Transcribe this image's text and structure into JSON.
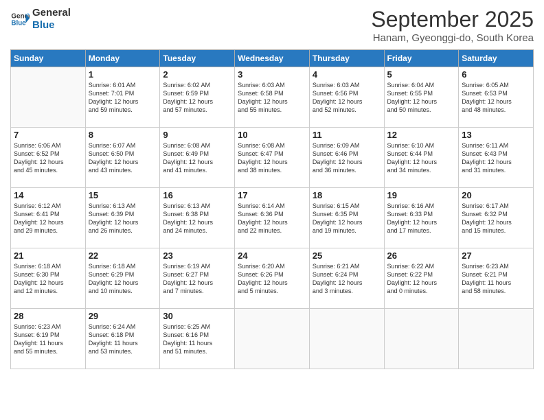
{
  "logo": {
    "line1": "General",
    "line2": "Blue"
  },
  "title": "September 2025",
  "subtitle": "Hanam, Gyeonggi-do, South Korea",
  "weekdays": [
    "Sunday",
    "Monday",
    "Tuesday",
    "Wednesday",
    "Thursday",
    "Friday",
    "Saturday"
  ],
  "weeks": [
    [
      {
        "day": "",
        "info": ""
      },
      {
        "day": "1",
        "info": "Sunrise: 6:01 AM\nSunset: 7:01 PM\nDaylight: 12 hours\nand 59 minutes."
      },
      {
        "day": "2",
        "info": "Sunrise: 6:02 AM\nSunset: 6:59 PM\nDaylight: 12 hours\nand 57 minutes."
      },
      {
        "day": "3",
        "info": "Sunrise: 6:03 AM\nSunset: 6:58 PM\nDaylight: 12 hours\nand 55 minutes."
      },
      {
        "day": "4",
        "info": "Sunrise: 6:03 AM\nSunset: 6:56 PM\nDaylight: 12 hours\nand 52 minutes."
      },
      {
        "day": "5",
        "info": "Sunrise: 6:04 AM\nSunset: 6:55 PM\nDaylight: 12 hours\nand 50 minutes."
      },
      {
        "day": "6",
        "info": "Sunrise: 6:05 AM\nSunset: 6:53 PM\nDaylight: 12 hours\nand 48 minutes."
      }
    ],
    [
      {
        "day": "7",
        "info": "Sunrise: 6:06 AM\nSunset: 6:52 PM\nDaylight: 12 hours\nand 45 minutes."
      },
      {
        "day": "8",
        "info": "Sunrise: 6:07 AM\nSunset: 6:50 PM\nDaylight: 12 hours\nand 43 minutes."
      },
      {
        "day": "9",
        "info": "Sunrise: 6:08 AM\nSunset: 6:49 PM\nDaylight: 12 hours\nand 41 minutes."
      },
      {
        "day": "10",
        "info": "Sunrise: 6:08 AM\nSunset: 6:47 PM\nDaylight: 12 hours\nand 38 minutes."
      },
      {
        "day": "11",
        "info": "Sunrise: 6:09 AM\nSunset: 6:46 PM\nDaylight: 12 hours\nand 36 minutes."
      },
      {
        "day": "12",
        "info": "Sunrise: 6:10 AM\nSunset: 6:44 PM\nDaylight: 12 hours\nand 34 minutes."
      },
      {
        "day": "13",
        "info": "Sunrise: 6:11 AM\nSunset: 6:43 PM\nDaylight: 12 hours\nand 31 minutes."
      }
    ],
    [
      {
        "day": "14",
        "info": "Sunrise: 6:12 AM\nSunset: 6:41 PM\nDaylight: 12 hours\nand 29 minutes."
      },
      {
        "day": "15",
        "info": "Sunrise: 6:13 AM\nSunset: 6:39 PM\nDaylight: 12 hours\nand 26 minutes."
      },
      {
        "day": "16",
        "info": "Sunrise: 6:13 AM\nSunset: 6:38 PM\nDaylight: 12 hours\nand 24 minutes."
      },
      {
        "day": "17",
        "info": "Sunrise: 6:14 AM\nSunset: 6:36 PM\nDaylight: 12 hours\nand 22 minutes."
      },
      {
        "day": "18",
        "info": "Sunrise: 6:15 AM\nSunset: 6:35 PM\nDaylight: 12 hours\nand 19 minutes."
      },
      {
        "day": "19",
        "info": "Sunrise: 6:16 AM\nSunset: 6:33 PM\nDaylight: 12 hours\nand 17 minutes."
      },
      {
        "day": "20",
        "info": "Sunrise: 6:17 AM\nSunset: 6:32 PM\nDaylight: 12 hours\nand 15 minutes."
      }
    ],
    [
      {
        "day": "21",
        "info": "Sunrise: 6:18 AM\nSunset: 6:30 PM\nDaylight: 12 hours\nand 12 minutes."
      },
      {
        "day": "22",
        "info": "Sunrise: 6:18 AM\nSunset: 6:29 PM\nDaylight: 12 hours\nand 10 minutes."
      },
      {
        "day": "23",
        "info": "Sunrise: 6:19 AM\nSunset: 6:27 PM\nDaylight: 12 hours\nand 7 minutes."
      },
      {
        "day": "24",
        "info": "Sunrise: 6:20 AM\nSunset: 6:26 PM\nDaylight: 12 hours\nand 5 minutes."
      },
      {
        "day": "25",
        "info": "Sunrise: 6:21 AM\nSunset: 6:24 PM\nDaylight: 12 hours\nand 3 minutes."
      },
      {
        "day": "26",
        "info": "Sunrise: 6:22 AM\nSunset: 6:22 PM\nDaylight: 12 hours\nand 0 minutes."
      },
      {
        "day": "27",
        "info": "Sunrise: 6:23 AM\nSunset: 6:21 PM\nDaylight: 11 hours\nand 58 minutes."
      }
    ],
    [
      {
        "day": "28",
        "info": "Sunrise: 6:23 AM\nSunset: 6:19 PM\nDaylight: 11 hours\nand 55 minutes."
      },
      {
        "day": "29",
        "info": "Sunrise: 6:24 AM\nSunset: 6:18 PM\nDaylight: 11 hours\nand 53 minutes."
      },
      {
        "day": "30",
        "info": "Sunrise: 6:25 AM\nSunset: 6:16 PM\nDaylight: 11 hours\nand 51 minutes."
      },
      {
        "day": "",
        "info": ""
      },
      {
        "day": "",
        "info": ""
      },
      {
        "day": "",
        "info": ""
      },
      {
        "day": "",
        "info": ""
      }
    ]
  ]
}
